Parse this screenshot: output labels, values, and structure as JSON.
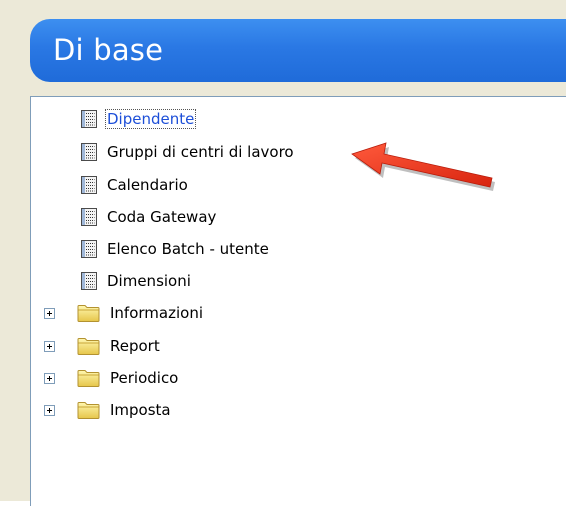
{
  "header": {
    "title": "Di base"
  },
  "tree": {
    "items": [
      {
        "label": "Dipendente",
        "icon": "report-doc-icon",
        "selected": true
      },
      {
        "label": "Gruppi di centri di lavoro",
        "icon": "report-doc-icon"
      },
      {
        "label": "Calendario",
        "icon": "report-doc-icon"
      },
      {
        "label": "Coda Gateway",
        "icon": "report-doc-icon"
      },
      {
        "label": "Elenco Batch - utente",
        "icon": "report-doc-icon"
      },
      {
        "label": "Dimensioni",
        "icon": "report-doc-icon"
      }
    ],
    "folders": [
      {
        "label": "Informazioni",
        "icon": "folder-icon",
        "expander": "plus-icon"
      },
      {
        "label": "Report",
        "icon": "folder-icon",
        "expander": "plus-icon"
      },
      {
        "label": "Periodico",
        "icon": "folder-icon",
        "expander": "plus-icon"
      },
      {
        "label": "Imposta",
        "icon": "folder-icon",
        "expander": "plus-icon"
      }
    ]
  },
  "colors": {
    "header_bg": "#2a78e4",
    "header_text": "#ffffff",
    "selected_text": "#1d4fd8",
    "arrow": "#e8321c",
    "chrome": "#ece9d8"
  }
}
